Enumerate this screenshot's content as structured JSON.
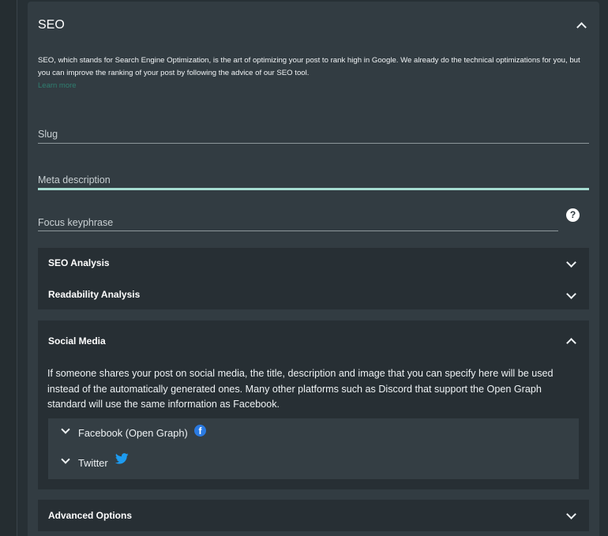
{
  "seo": {
    "title": "SEO",
    "intro": "SEO, which stands for Search Engine Optimization, is the art of optimizing your post to rank high in Google. We already do the technical optimizations for you, but you can improve the ranking of your post by following the advice of our SEO tool.",
    "learn_more": "Learn more",
    "fields": {
      "slug_label": "Slug",
      "meta_label": "Meta description",
      "focus_label": "Focus keyphrase"
    },
    "help_icon_glyph": "?"
  },
  "accordions": {
    "seo_analysis": "SEO Analysis",
    "readability": "Readability Analysis",
    "social_media": {
      "title": "Social Media",
      "description": "If someone shares your post on social media, the title, description and image that you can specify here will be used instead of the automatically generated ones. Many other platforms such as Discord that support the Open Graph standard will use the same information as Facebook.",
      "facebook": "Facebook (Open Graph)",
      "twitter": "Twitter"
    },
    "advanced": "Advanced Options"
  },
  "icons": {
    "expand_less": "chevron-up-icon",
    "expand_more": "chevron-down-icon",
    "help": "help-circle-icon",
    "facebook": "facebook-icon",
    "twitter": "twitter-icon"
  },
  "colors": {
    "active_underline": "#a6dcd1",
    "link": "#2f7e70",
    "facebook_blue": "#2a7ae2",
    "twitter_blue": "#1d9bf0"
  }
}
